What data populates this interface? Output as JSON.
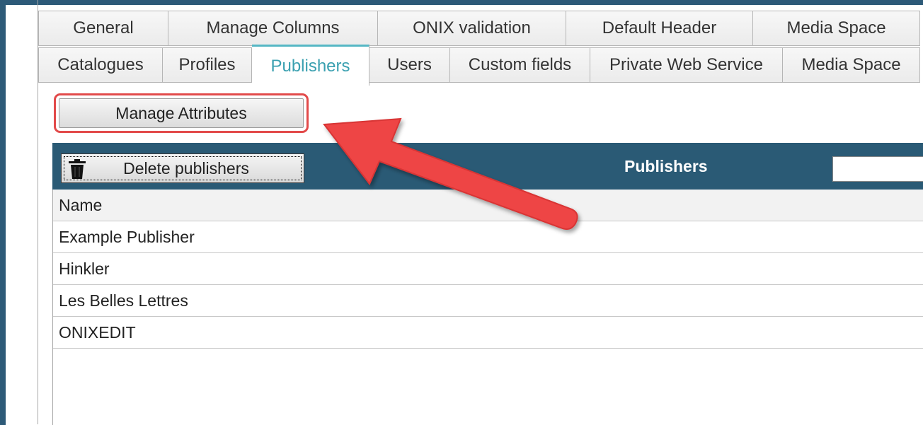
{
  "tabs_row1": [
    {
      "label": "General"
    },
    {
      "label": "Manage Columns"
    },
    {
      "label": "ONIX validation"
    },
    {
      "label": "Default Header"
    },
    {
      "label": "Media Space"
    }
  ],
  "tabs_row2": [
    {
      "label": "Catalogues"
    },
    {
      "label": "Profiles"
    },
    {
      "label": "Publishers",
      "active": true
    },
    {
      "label": "Users"
    },
    {
      "label": "Custom fields"
    },
    {
      "label": "Private Web Service"
    },
    {
      "label": "Media Space"
    }
  ],
  "manage_attributes_label": "Manage Attributes",
  "toolbar": {
    "delete_label": "Delete publishers",
    "title": "Publishers",
    "filter_value": ""
  },
  "table": {
    "column_header": "Name",
    "rows": [
      "Example Publisher",
      "Hinkler",
      "Les Belles Lettres",
      "ONIXEDIT"
    ]
  },
  "colors": {
    "frame": "#2d5a78",
    "header_bar": "#2a5a75",
    "active_tab": "#3aa0b0",
    "highlight": "#e24a4a"
  },
  "icons": [
    "trash-icon",
    "red-arrow-annotation"
  ]
}
